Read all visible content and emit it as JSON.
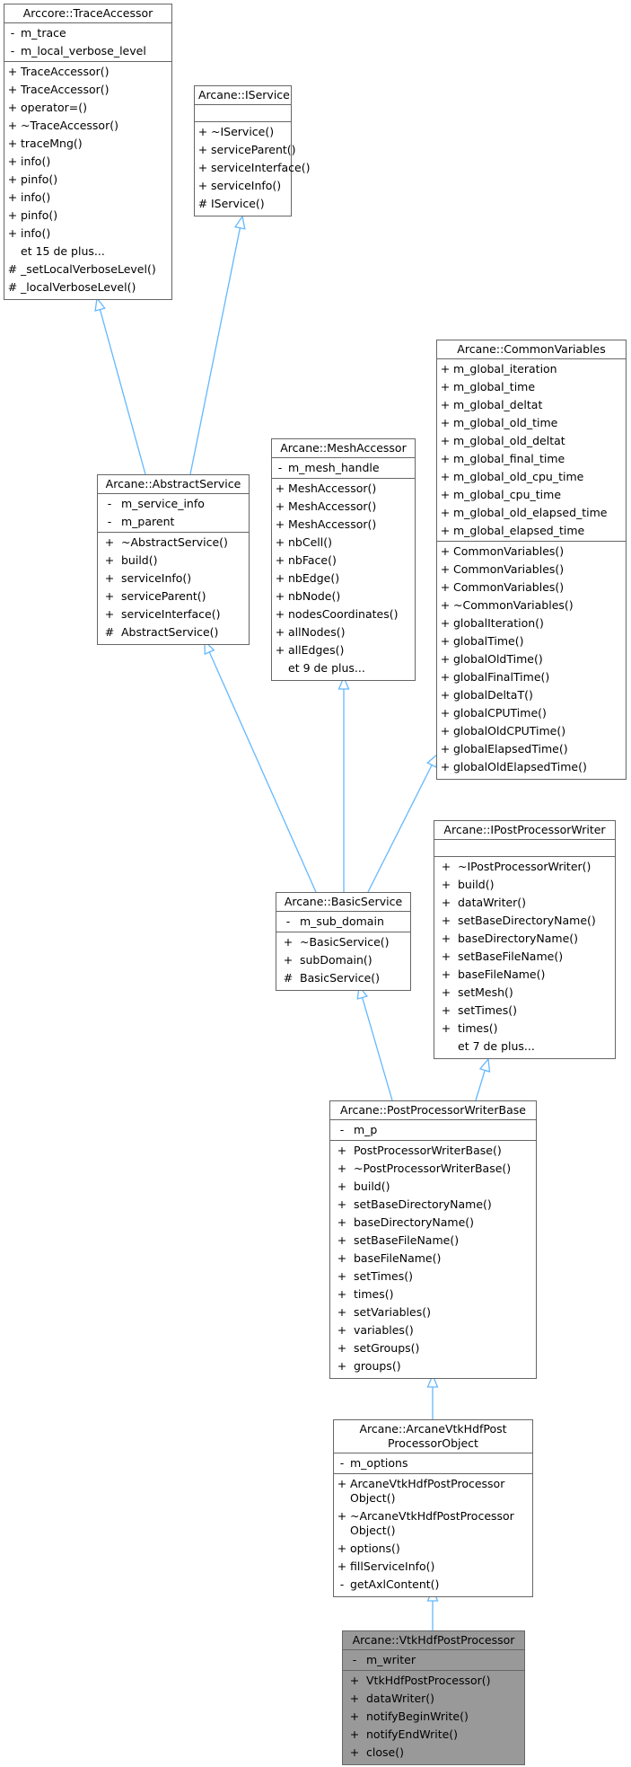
{
  "diagram": {
    "type": "UML class inheritance diagram",
    "edge_color": "#63b8ff",
    "classes": {
      "trace_accessor": {
        "name": "Arccore::TraceAccessor",
        "attributes": [
          {
            "vis": "-",
            "name": "m_trace"
          },
          {
            "vis": "-",
            "name": "m_local_verbose_level"
          }
        ],
        "operations": [
          {
            "vis": "+",
            "name": "TraceAccessor()"
          },
          {
            "vis": "+",
            "name": "TraceAccessor()"
          },
          {
            "vis": "+",
            "name": "operator=()"
          },
          {
            "vis": "+",
            "name": "~TraceAccessor()"
          },
          {
            "vis": "+",
            "name": "traceMng()"
          },
          {
            "vis": "+",
            "name": "info()"
          },
          {
            "vis": "+",
            "name": "pinfo()"
          },
          {
            "vis": "+",
            "name": "info()"
          },
          {
            "vis": "+",
            "name": "pinfo()"
          },
          {
            "vis": "+",
            "name": "info()"
          },
          {
            "vis": "",
            "name": "et 15 de plus..."
          },
          {
            "vis": "#",
            "name": "_setLocalVerboseLevel()"
          },
          {
            "vis": "#",
            "name": "_localVerboseLevel()"
          }
        ]
      },
      "iservice": {
        "name": "Arcane::IService",
        "attributes": [],
        "operations": [
          {
            "vis": "+",
            "name": "~IService()"
          },
          {
            "vis": "+",
            "name": "serviceParent()"
          },
          {
            "vis": "+",
            "name": "serviceInterface()"
          },
          {
            "vis": "+",
            "name": "serviceInfo()"
          },
          {
            "vis": "#",
            "name": "IService()"
          }
        ]
      },
      "common_variables": {
        "name": "Arcane::CommonVariables",
        "attributes": [
          {
            "vis": "+",
            "name": "m_global_iteration"
          },
          {
            "vis": "+",
            "name": "m_global_time"
          },
          {
            "vis": "+",
            "name": "m_global_deltat"
          },
          {
            "vis": "+",
            "name": "m_global_old_time"
          },
          {
            "vis": "+",
            "name": "m_global_old_deltat"
          },
          {
            "vis": "+",
            "name": "m_global_final_time"
          },
          {
            "vis": "+",
            "name": "m_global_old_cpu_time"
          },
          {
            "vis": "+",
            "name": "m_global_cpu_time"
          },
          {
            "vis": "+",
            "name": "m_global_old_elapsed_time"
          },
          {
            "vis": "+",
            "name": "m_global_elapsed_time"
          }
        ],
        "operations": [
          {
            "vis": "+",
            "name": "CommonVariables()"
          },
          {
            "vis": "+",
            "name": "CommonVariables()"
          },
          {
            "vis": "+",
            "name": "CommonVariables()"
          },
          {
            "vis": "+",
            "name": "~CommonVariables()"
          },
          {
            "vis": "+",
            "name": "globalIteration()"
          },
          {
            "vis": "+",
            "name": "globalTime()"
          },
          {
            "vis": "+",
            "name": "globalOldTime()"
          },
          {
            "vis": "+",
            "name": "globalFinalTime()"
          },
          {
            "vis": "+",
            "name": "globalDeltaT()"
          },
          {
            "vis": "+",
            "name": "globalCPUTime()"
          },
          {
            "vis": "+",
            "name": "globalOldCPUTime()"
          },
          {
            "vis": "+",
            "name": "globalElapsedTime()"
          },
          {
            "vis": "+",
            "name": "globalOldElapsedTime()"
          }
        ]
      },
      "mesh_accessor": {
        "name": "Arcane::MeshAccessor",
        "attributes": [
          {
            "vis": "-",
            "name": "m_mesh_handle"
          }
        ],
        "operations": [
          {
            "vis": "+",
            "name": "MeshAccessor()"
          },
          {
            "vis": "+",
            "name": "MeshAccessor()"
          },
          {
            "vis": "+",
            "name": "MeshAccessor()"
          },
          {
            "vis": "+",
            "name": "nbCell()"
          },
          {
            "vis": "+",
            "name": "nbFace()"
          },
          {
            "vis": "+",
            "name": "nbEdge()"
          },
          {
            "vis": "+",
            "name": "nbNode()"
          },
          {
            "vis": "+",
            "name": "nodesCoordinates()"
          },
          {
            "vis": "+",
            "name": "allNodes()"
          },
          {
            "vis": "+",
            "name": "allEdges()"
          },
          {
            "vis": "",
            "name": "et 9 de plus..."
          }
        ]
      },
      "abstract_service": {
        "name": "Arcane::AbstractService",
        "attributes": [
          {
            "vis": "-",
            "name": "m_service_info"
          },
          {
            "vis": "-",
            "name": "m_parent"
          }
        ],
        "operations": [
          {
            "vis": "+",
            "name": "~AbstractService()"
          },
          {
            "vis": "+",
            "name": "build()"
          },
          {
            "vis": "+",
            "name": "serviceInfo()"
          },
          {
            "vis": "+",
            "name": "serviceParent()"
          },
          {
            "vis": "+",
            "name": "serviceInterface()"
          },
          {
            "vis": "#",
            "name": "AbstractService()"
          }
        ]
      },
      "ipost_processor_writer": {
        "name": "Arcane::IPostProcessorWriter",
        "attributes": [],
        "operations": [
          {
            "vis": "+",
            "name": "~IPostProcessorWriter()"
          },
          {
            "vis": "+",
            "name": "build()"
          },
          {
            "vis": "+",
            "name": "dataWriter()"
          },
          {
            "vis": "+",
            "name": "setBaseDirectoryName()"
          },
          {
            "vis": "+",
            "name": "baseDirectoryName()"
          },
          {
            "vis": "+",
            "name": "setBaseFileName()"
          },
          {
            "vis": "+",
            "name": "baseFileName()"
          },
          {
            "vis": "+",
            "name": "setMesh()"
          },
          {
            "vis": "+",
            "name": "setTimes()"
          },
          {
            "vis": "+",
            "name": "times()"
          },
          {
            "vis": "",
            "name": "et 7 de plus..."
          }
        ]
      },
      "basic_service": {
        "name": "Arcane::BasicService",
        "attributes": [
          {
            "vis": "-",
            "name": "m_sub_domain"
          }
        ],
        "operations": [
          {
            "vis": "+",
            "name": "~BasicService()"
          },
          {
            "vis": "+",
            "name": "subDomain()"
          },
          {
            "vis": "#",
            "name": "BasicService()"
          }
        ]
      },
      "post_processor_writer_base": {
        "name": "Arcane::PostProcessorWriterBase",
        "attributes": [
          {
            "vis": "-",
            "name": "m_p"
          }
        ],
        "operations": [
          {
            "vis": "+",
            "name": "PostProcessorWriterBase()"
          },
          {
            "vis": "+",
            "name": "~PostProcessorWriterBase()"
          },
          {
            "vis": "+",
            "name": "build()"
          },
          {
            "vis": "+",
            "name": "setBaseDirectoryName()"
          },
          {
            "vis": "+",
            "name": "baseDirectoryName()"
          },
          {
            "vis": "+",
            "name": "setBaseFileName()"
          },
          {
            "vis": "+",
            "name": "baseFileName()"
          },
          {
            "vis": "+",
            "name": "setTimes()"
          },
          {
            "vis": "+",
            "name": "times()"
          },
          {
            "vis": "+",
            "name": "setVariables()"
          },
          {
            "vis": "+",
            "name": "variables()"
          },
          {
            "vis": "+",
            "name": "setGroups()"
          },
          {
            "vis": "+",
            "name": "groups()"
          }
        ]
      },
      "arcane_vtk_hdf_post_processor_object": {
        "name": "Arcane::ArcaneVtkHdfPost\nProcessorObject",
        "attributes": [
          {
            "vis": "-",
            "name": "m_options"
          }
        ],
        "operations": [
          {
            "vis": "+",
            "name": "ArcaneVtkHdfPostProcessor\nObject()"
          },
          {
            "vis": "+",
            "name": "~ArcaneVtkHdfPostProcessor\nObject()"
          },
          {
            "vis": "+",
            "name": "options()"
          },
          {
            "vis": "+",
            "name": "fillServiceInfo()"
          },
          {
            "vis": "-",
            "name": "getAxlContent()"
          }
        ]
      },
      "vtk_hdf_post_processor": {
        "name": "Arcane::VtkHdfPostProcessor",
        "highlighted": true,
        "attributes": [
          {
            "vis": "-",
            "name": "m_writer"
          }
        ],
        "operations": [
          {
            "vis": "+",
            "name": "VtkHdfPostProcessor()"
          },
          {
            "vis": "+",
            "name": "dataWriter()"
          },
          {
            "vis": "+",
            "name": "notifyBeginWrite()"
          },
          {
            "vis": "+",
            "name": "notifyEndWrite()"
          },
          {
            "vis": "+",
            "name": "close()"
          }
        ]
      }
    },
    "edges": [
      {
        "from": "abstract_service",
        "to": "trace_accessor",
        "kind": "inheritance"
      },
      {
        "from": "abstract_service",
        "to": "iservice",
        "kind": "inheritance"
      },
      {
        "from": "basic_service",
        "to": "abstract_service",
        "kind": "inheritance"
      },
      {
        "from": "basic_service",
        "to": "mesh_accessor",
        "kind": "inheritance"
      },
      {
        "from": "basic_service",
        "to": "common_variables",
        "kind": "inheritance"
      },
      {
        "from": "post_processor_writer_base",
        "to": "basic_service",
        "kind": "inheritance"
      },
      {
        "from": "post_processor_writer_base",
        "to": "ipost_processor_writer",
        "kind": "inheritance"
      },
      {
        "from": "arcane_vtk_hdf_post_processor_object",
        "to": "post_processor_writer_base",
        "kind": "inheritance"
      },
      {
        "from": "vtk_hdf_post_processor",
        "to": "arcane_vtk_hdf_post_processor_object",
        "kind": "inheritance"
      }
    ]
  }
}
